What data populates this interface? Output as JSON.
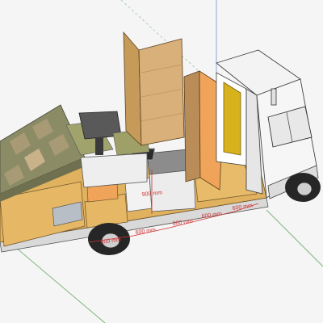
{
  "viewport": {
    "background": "#f5f5f5"
  },
  "colors": {
    "axis_green": "#7fb77f",
    "axis_blue": "#8fa8d8",
    "dimension_red": "#d03030",
    "plywood": "#e0b15e",
    "plywood_dark": "#c8923e",
    "cab_white": "#f3f3f3",
    "tire": "#262626",
    "yellow_panel": "#d8b21c",
    "orange_panel": "#f0a45a"
  },
  "dimensions": [
    {
      "id": "dim-900",
      "text": "900 mm"
    },
    {
      "id": "dim-600-a",
      "text": "600 mm"
    },
    {
      "id": "dim-600-b",
      "text": "600 mm"
    },
    {
      "id": "dim-600-c",
      "text": "600 mm"
    },
    {
      "id": "dim-600-d",
      "text": "600 mm"
    },
    {
      "id": "dim-600-e",
      "text": "600 mm"
    }
  ],
  "objects": [
    "truck-cab",
    "truck-chassis",
    "camper-floor",
    "bed-mattress",
    "dining-table",
    "wardrobe-panel",
    "kitchen-cabinet",
    "sink",
    "orange-partition",
    "yellow-cab-wall",
    "front-wheel",
    "rear-wheel"
  ]
}
